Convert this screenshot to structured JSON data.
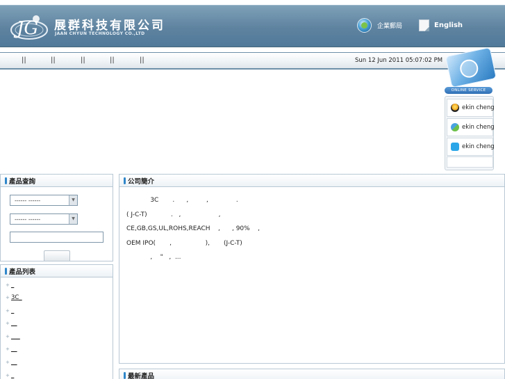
{
  "header": {
    "brand_cn": "展群科技有限公司",
    "brand_en": "JAAN CHYUN TECHNOLOGY CO.,LTD",
    "mail_label": "企業郵局",
    "english_label": "English"
  },
  "nav": {
    "separators": [
      "||",
      "||",
      "||",
      "||",
      "||"
    ],
    "datetime": "Sun 12 Jun 2011 05:07:02 PM UTC"
  },
  "online_service": {
    "badge": "ONLINE SERVICE",
    "contacts": [
      {
        "label": "ekin cheng",
        "icon": "qq-icon"
      },
      {
        "label": "ekin cheng",
        "icon": "msn-icon"
      },
      {
        "label": "ekin cheng",
        "icon": "skype-icon"
      }
    ]
  },
  "search_panel": {
    "title": "產品查詢",
    "select1_value": "------          ------",
    "select2_value": "------          ------",
    "keyword_value": "",
    "search_button": ""
  },
  "product_list": {
    "title": "產品列表",
    "items": [
      "_",
      "3C_",
      "_",
      "__",
      "___",
      "__",
      "__",
      "_"
    ]
  },
  "company": {
    "title": "公司簡介",
    "lines": [
      "            3C       .      ,         ,              .",
      "( J-C-T)            .   ,                   ,",
      "CE,GB,GS,UL,ROHS,REACH    ,      , 90%    ,",
      "OEM IPO(       ,                 ),       (J-C-T)",
      "            ,    \"   ,  ..."
    ]
  },
  "latest": {
    "title": "最新產品"
  },
  "colors": {
    "header_blue": "#5e83a0",
    "accent_blue": "#2f86c9",
    "border": "#b8c8d4"
  }
}
